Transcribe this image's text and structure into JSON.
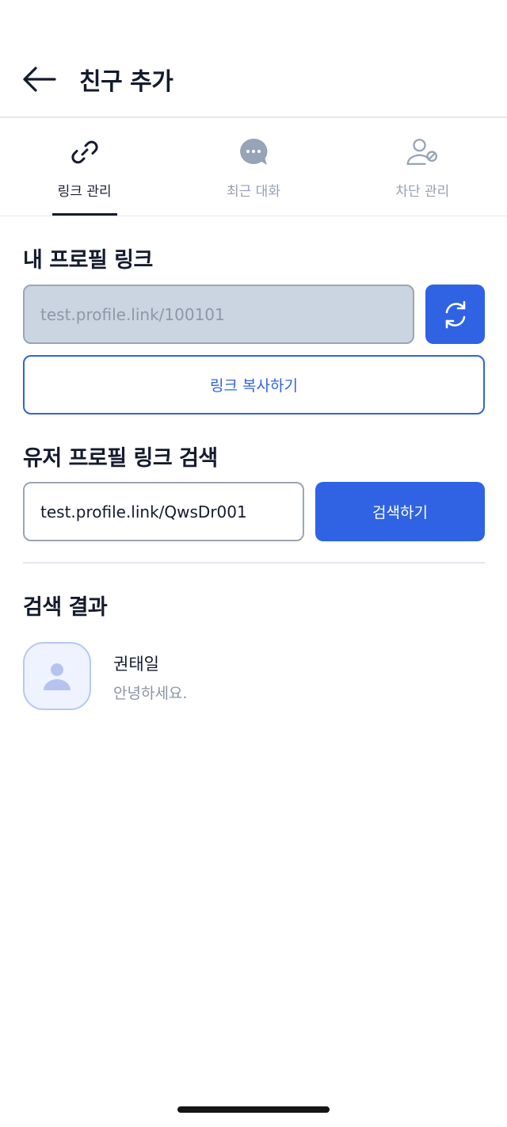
{
  "header": {
    "title": "친구 추가"
  },
  "tabs": [
    {
      "label": "링크 관리",
      "icon": "link-icon",
      "active": true
    },
    {
      "label": "최근 대화",
      "icon": "chat-bubble-icon",
      "active": false
    },
    {
      "label": "차단 관리",
      "icon": "user-block-icon",
      "active": false
    }
  ],
  "my_link": {
    "title": "내 프로필 링크",
    "value": "test.profile.link/100101",
    "copy_label": "링크 복사하기"
  },
  "search": {
    "title": "유저 프로필 링크 검색",
    "value": "test.profile.link/QwsDr001",
    "button_label": "검색하기"
  },
  "results": {
    "title": "검색 결과",
    "items": [
      {
        "name": "권태일",
        "status": "안녕하세요."
      }
    ]
  },
  "colors": {
    "primary": "#2f63e3",
    "text": "#141b2d",
    "muted": "#97a0b0"
  }
}
